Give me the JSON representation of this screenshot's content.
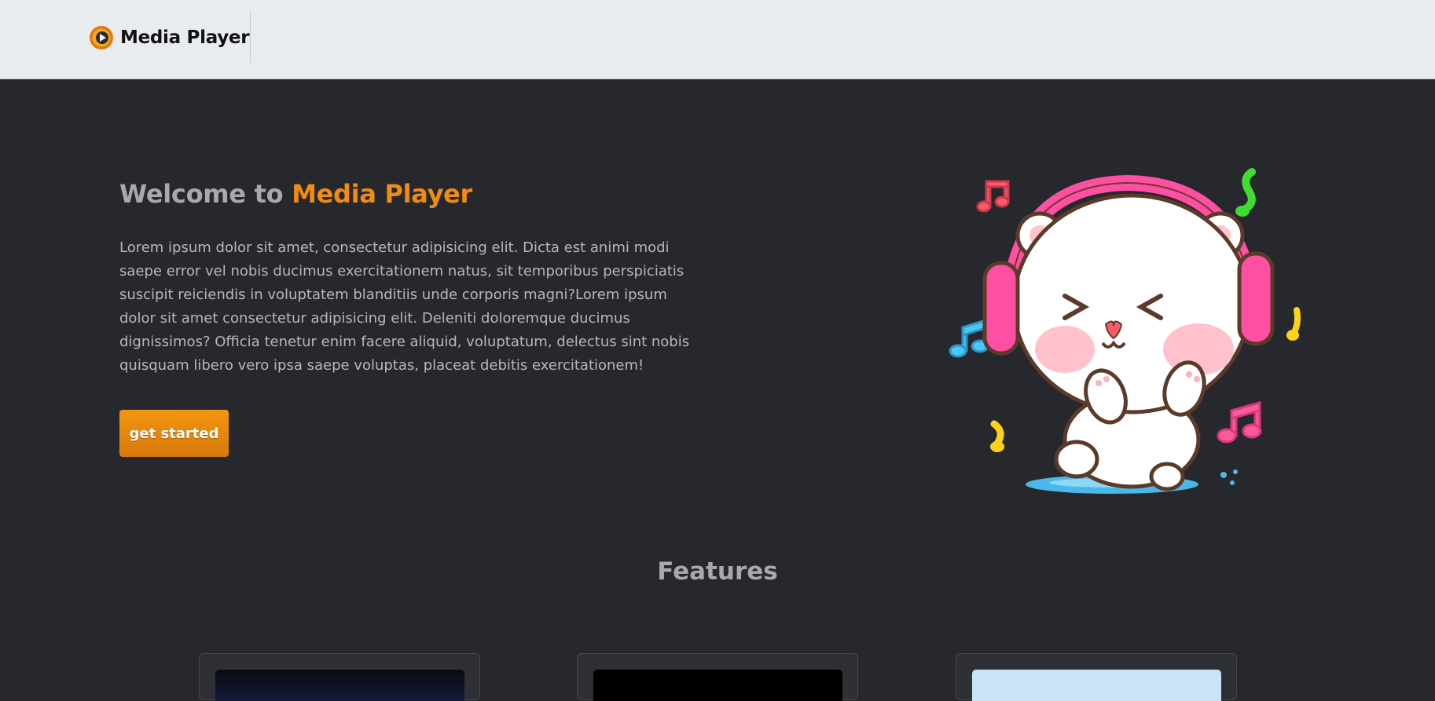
{
  "nav": {
    "brand": "Media Player",
    "logo_icon": "media-player-play-icon"
  },
  "hero": {
    "title_prefix": "Welcome to ",
    "title_accent": "Media Player",
    "description": "Lorem ipsum dolor sit amet, consectetur adipisicing elit. Dicta est animi modi saepe error vel nobis ducimus exercitationem natus, sit temporibus perspiciatis suscipit reiciendis in voluptatem blanditiis unde corporis magni?Lorem ipsum dolor sit amet consectetur adipisicing elit. Deleniti doloremque ducimus dignissimos? Officia tenetur enim facere aliquid, voluptatum, delectus sint nobis quisquam libero vero ipsa saepe voluptas, placeat debitis exercitationem!",
    "cta_label": "get started",
    "illustration": "polar-bear-with-headphones-dancing"
  },
  "features": {
    "title": "Features",
    "cards": [
      {
        "thumbnail": "dark-blue-video-thumbnail"
      },
      {
        "thumbnail": "black-video-thumbnail"
      },
      {
        "thumbnail": "light-blue-image-thumbnail"
      }
    ]
  },
  "colors": {
    "page_bg": "#26282d",
    "navbar_bg": "#e9ecef",
    "accent": "#f08c12",
    "heading": "#a8a9ab",
    "body_text": "#b6b8bb"
  }
}
